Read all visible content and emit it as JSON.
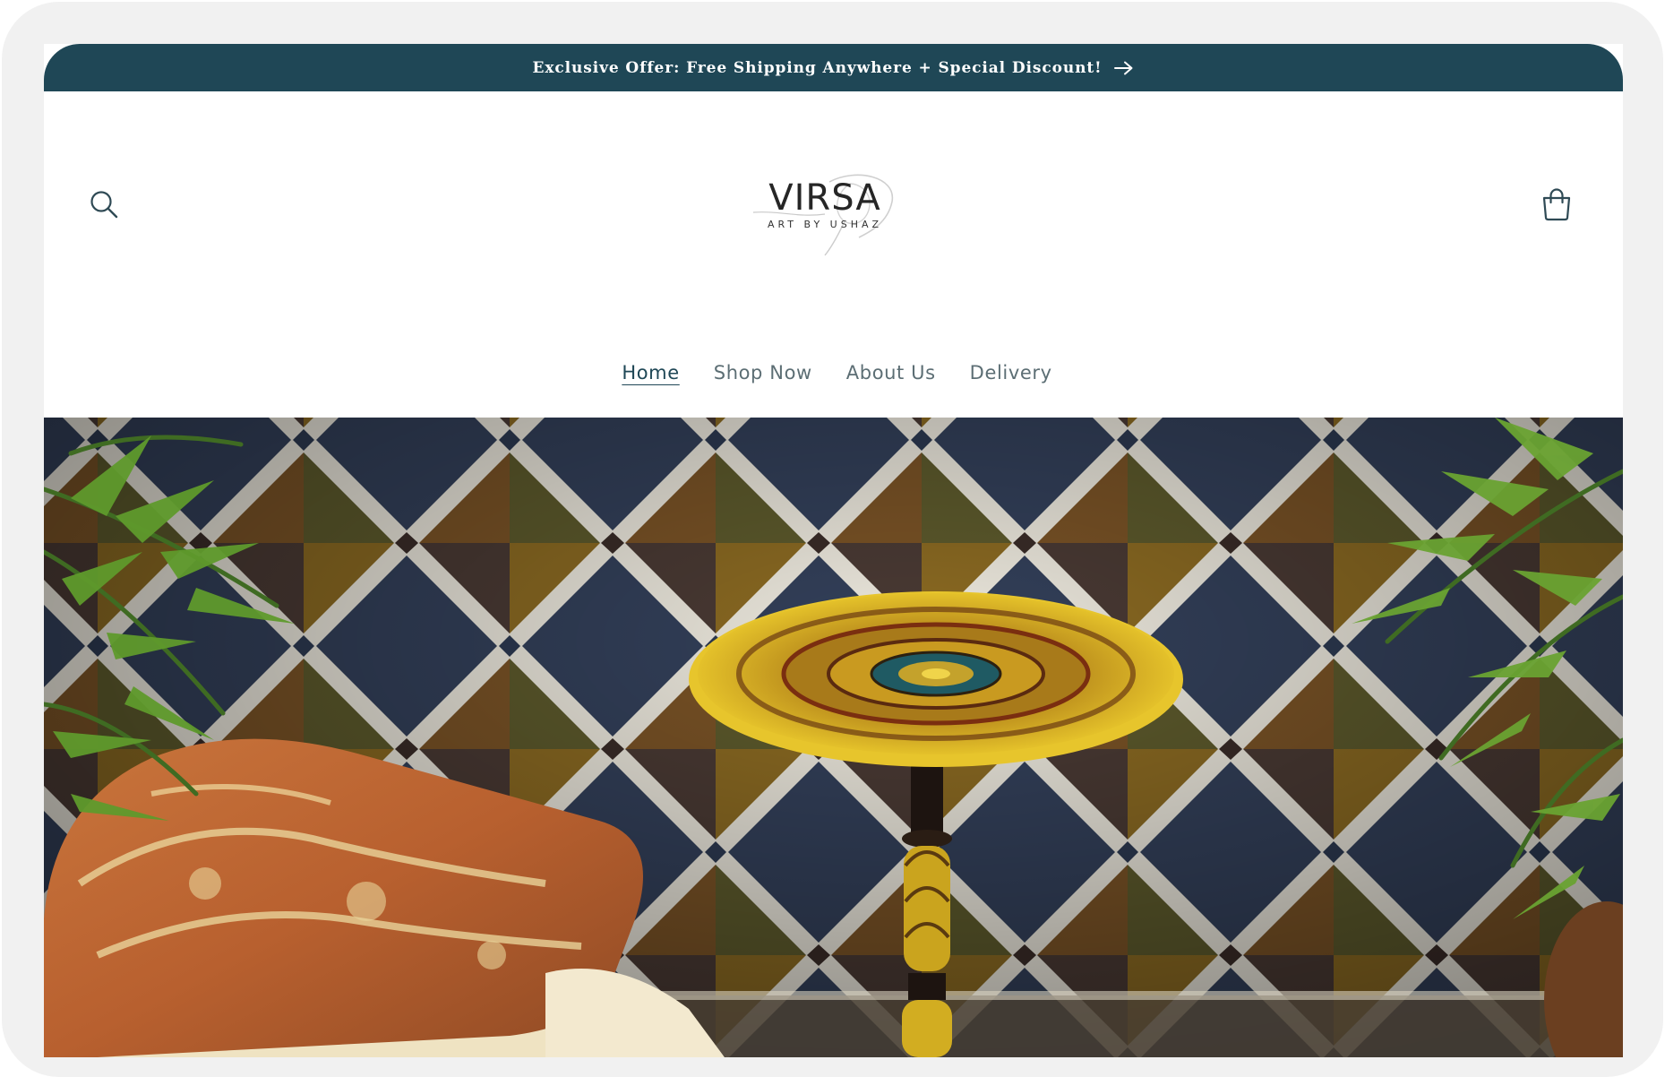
{
  "announcement": {
    "text": "Exclusive Offer: Free Shipping Anywhere + Special Discount!",
    "arrow_icon": "arrow-right-icon"
  },
  "header": {
    "search_icon": "search-icon",
    "cart_icon": "cart-icon",
    "logo": {
      "word": "VIRSA",
      "tagline": "ART BY USHAZ"
    }
  },
  "nav": {
    "items": [
      {
        "label": "Home",
        "active": true
      },
      {
        "label": "Shop Now",
        "active": false
      },
      {
        "label": "About Us",
        "active": false
      },
      {
        "label": "Delivery",
        "active": false
      }
    ]
  },
  "colors": {
    "announcement_bg": "#1f4756",
    "nav_active": "#1f4756",
    "nav_inactive": "#5c6e74",
    "page_bg": "#ffffff"
  }
}
